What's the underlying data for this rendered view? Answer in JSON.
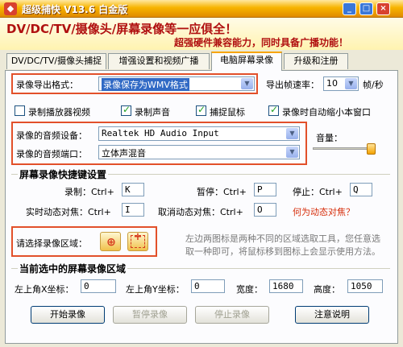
{
  "window": {
    "title": "超级捕快 V13.6 白金版",
    "app_icon": "app-logo-icon",
    "buttons": {
      "minimize": "_",
      "maximize": "□",
      "close": "×"
    }
  },
  "banner": {
    "headline": "DV/DC/TV/摄像头/屏幕录像等一应俱全！",
    "tagline": "超强硬件兼容能力，同时具备广播功能！"
  },
  "tabs": [
    {
      "label": "DV/DC/TV/摄像头捕捉"
    },
    {
      "label": "增强设置和视频广播"
    },
    {
      "label": "电脑屏幕录像"
    },
    {
      "label": "升级和注册"
    }
  ],
  "export": {
    "format_label": "录像导出格式：",
    "format_value": "录像保存为WMV格式",
    "framerate_label": "导出帧速率：",
    "framerate_value": "10",
    "framerate_unit": "帧/秒"
  },
  "options": [
    {
      "label": "录制播放器视频",
      "checked": false
    },
    {
      "label": "录制声音",
      "checked": true
    },
    {
      "label": "捕捉鼠标",
      "checked": true
    },
    {
      "label": "录像时自动缩小本窗口",
      "checked": true
    }
  ],
  "audio": {
    "device_label": "录像的音频设备：",
    "device_value": "Realtek HD Audio Input",
    "port_label": "录像的音频端口：",
    "port_value": "立体声混音",
    "volume_label": "音量："
  },
  "hotkeys": {
    "title": "屏幕录像快捷键设置",
    "record_label": "录制：Ctrl+",
    "record_key": "K",
    "pause_label": "暂停：Ctrl+",
    "pause_key": "P",
    "stop_label": "停止：Ctrl+",
    "stop_key": "Q",
    "track_label": "实时动态对焦：Ctrl+",
    "track_key": "I",
    "cancel_track_label": "取消动态对焦：Ctrl+",
    "cancel_track_key": "O",
    "what_is_link": "何为动态对焦？"
  },
  "area": {
    "label": "请选择录像区域：",
    "button1_icon": "crosshair-icon",
    "button2_icon": "dashed-rect-add-icon",
    "hint": "左边两图标是两种不同的区域选取工具，您任意选取一种即可，将鼠标移到图标上会显示使用方法。"
  },
  "region": {
    "title": "当前选中的屏幕录像区域",
    "left_x_label": "左上角X坐标：",
    "left_x": "0",
    "left_y_label": "左上角Y坐标：",
    "left_y": "0",
    "width_label": "宽度：",
    "width": "1680",
    "height_label": "高度：",
    "height": "1050"
  },
  "actions": {
    "start": "开始录像",
    "pause": "暂停录像",
    "stop": "停止录像",
    "help": "注意说明"
  },
  "colors": {
    "highlight_box": "#e2502a",
    "banner_text": "#b01010",
    "link": "#d62d0a"
  }
}
